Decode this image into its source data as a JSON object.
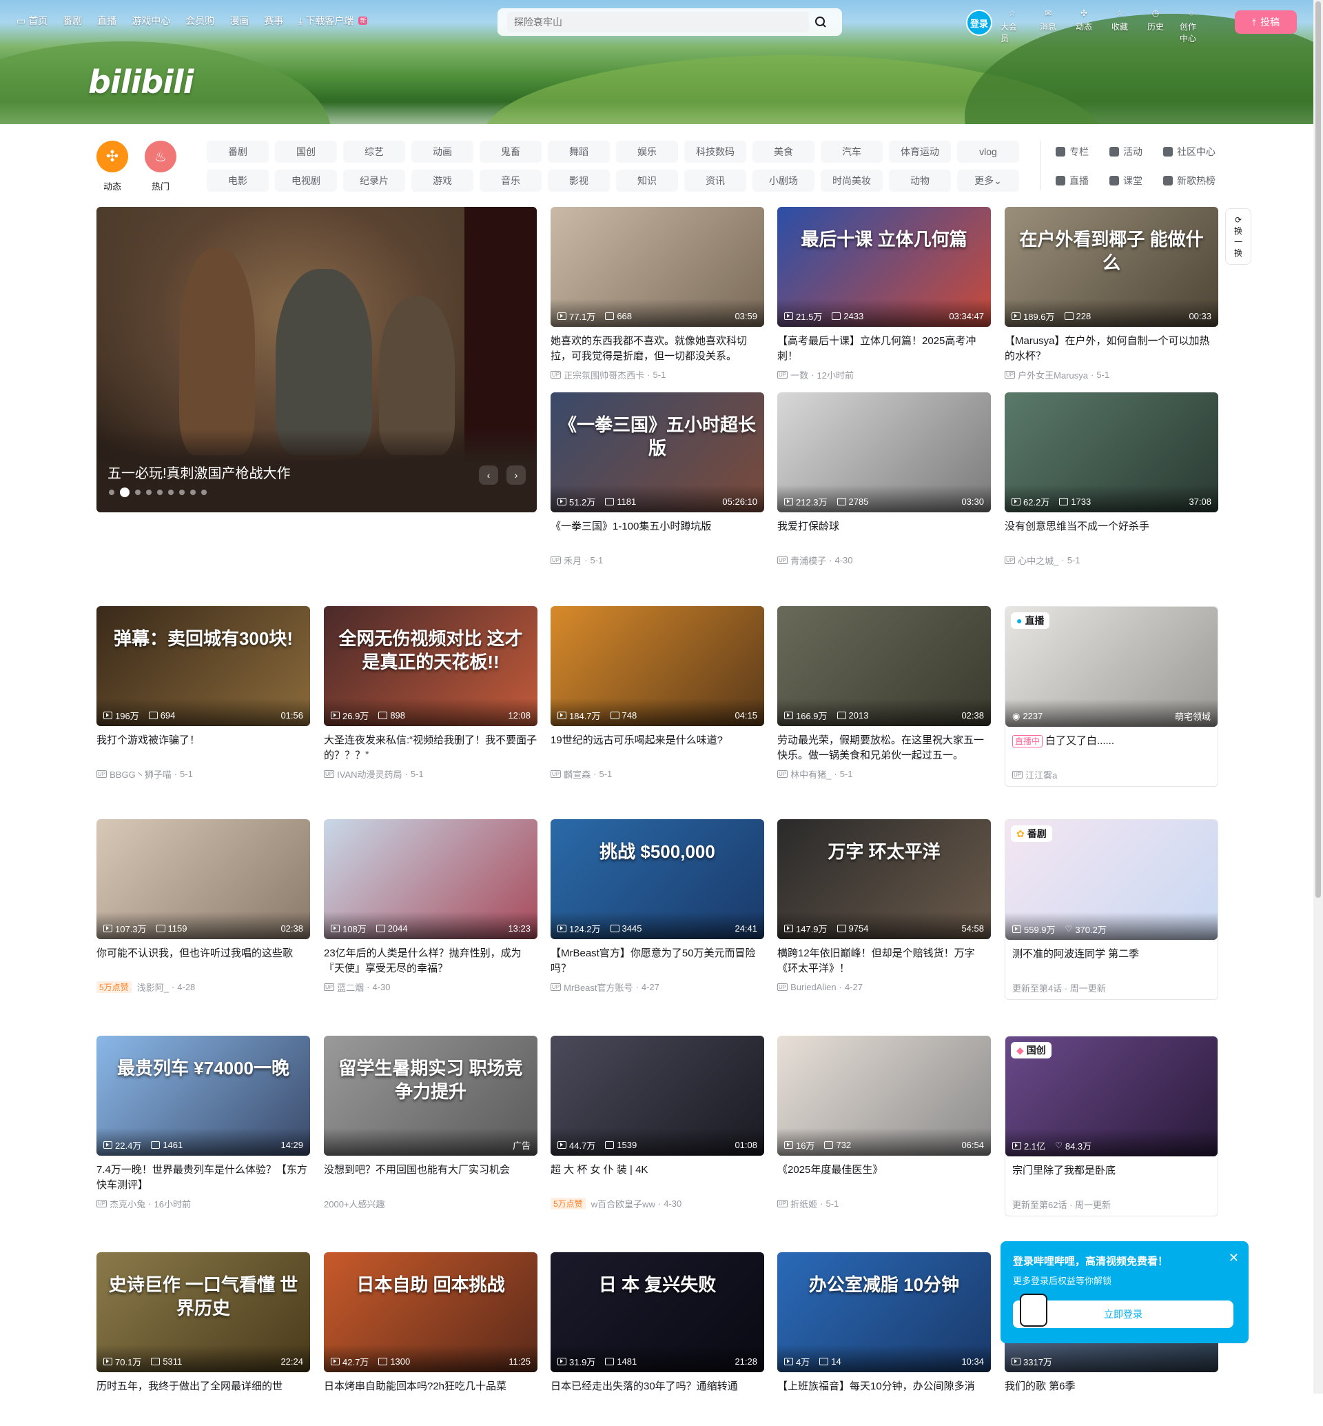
{
  "topnav": {
    "items": [
      "首页",
      "番剧",
      "直播",
      "游戏中心",
      "会员购",
      "漫画",
      "赛事",
      "下载客户端"
    ],
    "new_badge": "新"
  },
  "search": {
    "placeholder": "探险衰牢山"
  },
  "user": {
    "login": "登录",
    "items": [
      "大会员",
      "消息",
      "动态",
      "收藏",
      "历史",
      "创作中心"
    ],
    "upload": "投稿"
  },
  "logo": "bilibili",
  "channels": {
    "big": [
      "动态",
      "热门"
    ],
    "tags": [
      "番剧",
      "国创",
      "综艺",
      "动画",
      "鬼畜",
      "舞蹈",
      "娱乐",
      "科技数码",
      "美食",
      "汽车",
      "体育运动",
      "vlog",
      "电影",
      "电视剧",
      "纪录片",
      "游戏",
      "音乐",
      "影视",
      "知识",
      "资讯",
      "小剧场",
      "时尚美妆",
      "动物",
      "更多"
    ],
    "links": [
      "专栏",
      "活动",
      "社区中心",
      "直播",
      "课堂",
      "新歌热榜"
    ]
  },
  "carousel": {
    "title": "五一必玩!真刺激国产枪战大作",
    "dots": 9,
    "active": 1
  },
  "refresh": [
    "换",
    "一",
    "换"
  ],
  "cards": [
    {
      "views": "77.1万",
      "dm": "668",
      "dur": "03:59",
      "title": "她喜欢的东西我都不喜欢。就像她喜欢科切拉，可我觉得是折磨，但一切都没关系。",
      "up": "正宗氛围帅哥杰西卡",
      "date": "5-1",
      "c1": "#c9b9a6",
      "c2": "#7a6a58"
    },
    {
      "views": "21.5万",
      "dm": "2433",
      "dur": "03:34:47",
      "title": "【高考最后十课】立体几何篇！2025高考冲刺！",
      "up": "一数",
      "date": "12小时前",
      "c1": "#2b4fa8",
      "c2": "#c94a3a",
      "overlay": "最后十课 立体几何篇"
    },
    {
      "views": "189.6万",
      "dm": "228",
      "dur": "00:33",
      "title": "【Marusya】在户外，如何自制一个可以加热的水杯？",
      "up": "户外女王Marusya",
      "date": "5-1",
      "c1": "#9a8f7a",
      "c2": "#4e4536",
      "overlay": "在户外看到椰子 能做什么"
    },
    {
      "views": "51.2万",
      "dm": "1181",
      "dur": "05:26:10",
      "title": "《一拳三国》1-100集五小时蹲坑版",
      "up": "禾月",
      "date": "5-1",
      "c1": "#3a4a6a",
      "c2": "#7a4a3a",
      "overlay": "《一拳三国》五小时超长版"
    },
    {
      "views": "212.3万",
      "dm": "2785",
      "dur": "03:30",
      "title": "我爱打保龄球",
      "up": "青浦模子",
      "date": "4-30",
      "c1": "#d8d8d8",
      "c2": "#7a7a7a"
    },
    {
      "views": "62.2万",
      "dm": "1733",
      "dur": "37:08",
      "title": "没有创意思维当不成一个好杀手",
      "up": "心中之城_",
      "date": "5-1",
      "c1": "#5a7a6a",
      "c2": "#2a3a32"
    },
    {
      "views": "196万",
      "dm": "694",
      "dur": "01:56",
      "title": "我打个游戏被诈骗了！",
      "up": "BBGG丶狮子喵",
      "date": "5-1",
      "c1": "#3a2a1a",
      "c2": "#8a6a3a",
      "overlay": "弹幕：卖回城有300块!"
    },
    {
      "views": "26.9万",
      "dm": "898",
      "dur": "12:08",
      "title": "大圣连夜发来私信:“视频给我删了！我不要面子的？？？”",
      "up": "IVAN动漫灵药局",
      "date": "5-1",
      "c1": "#4a2a2a",
      "c2": "#c25a3a",
      "overlay": "全网无伤视频对比 这才是真正的天花板!!"
    },
    {
      "views": "184.7万",
      "dm": "748",
      "dur": "04:15",
      "title": "19世纪的远古可乐喝起来是什么味道?",
      "up": "麟宣森",
      "date": "5-1",
      "c1": "#d88a2a",
      "c2": "#5a3a1a"
    },
    {
      "views": "166.9万",
      "dm": "2013",
      "dur": "02:38",
      "title": "劳动最光荣，假期要放松。在这里祝大家五一快乐。做一锅美食和兄弟伙一起过五一。",
      "up": "林中有猪_",
      "date": "5-1",
      "c1": "#6a6a5a",
      "c2": "#3a3a2e"
    },
    {
      "views": "559.9万",
      "dm": "370.2万",
      "dur": "",
      "title": "测不准的阿波连同学 第二季",
      "up": "",
      "date": "",
      "meta": "更新至第4话 · 周一更新",
      "c1": "#f4e6f2",
      "c2": "#c8d8f2",
      "corner": "番剧",
      "like": true
    },
    {
      "views": "107.3万",
      "dm": "1159",
      "dur": "02:38",
      "title": "你可能不认识我，但也许听过我唱的这些歌",
      "up": "浅影阿_",
      "date": "4-28",
      "hot": "5万点赞",
      "c1": "#d8c8b8",
      "c2": "#8a7a6a"
    },
    {
      "views": "108万",
      "dm": "2044",
      "dur": "13:23",
      "title": "23亿年后的人类是什么样？抛弃性别，成为『天使』享受无尽的幸福？",
      "up": "蓝二烟",
      "date": "4-30",
      "c1": "#c8d8e8",
      "c2": "#a84a5a"
    },
    {
      "views": "124.2万",
      "dm": "3445",
      "dur": "24:41",
      "title": "【MrBeast官方】你愿意为了50万美元而冒险吗？",
      "up": "MrBeast官方账号",
      "date": "4-27",
      "c1": "#2a6aa8",
      "c2": "#1a3a6a",
      "overlay": "挑战 $500,000"
    },
    {
      "views": "147.9万",
      "dm": "9754",
      "dur": "54:58",
      "title": "横跨12年依旧巅峰！但却是个赔钱货！万字《环太平洋》！",
      "up": "BuriedAlien",
      "date": "4-27",
      "c1": "#2a2a2a",
      "c2": "#6a5a4a",
      "overlay": "万字 环太平洋"
    },
    {
      "views": "44.7万",
      "dm": "1539",
      "dur": "01:08",
      "title": "超 大 杯 女 仆 装 | 4K",
      "up": "w百合欧皇子ww",
      "date": "4-30",
      "hot": "5万点赞",
      "c1": "#4a4a5a",
      "c2": "#1a1a22"
    },
    {
      "views": "22.4万",
      "dm": "1461",
      "dur": "14:29",
      "title": "7.4万一晚！世界最贵列车是什么体验？【东方快车测评】",
      "up": "杰克小兔",
      "date": "16小时前",
      "c1": "#8ab8e8",
      "c2": "#3a4a6a",
      "overlay": "最贵列车 ¥74000一晚"
    },
    {
      "views": "",
      "dm": "",
      "dur": "广告",
      "title": "没想到吧？不用回国也能有大厂实习机会",
      "up": "",
      "date": "",
      "meta": "2000+人感兴趣",
      "c1": "#9a9a9a",
      "c2": "#5a5a5a",
      "overlay": "留学生暑期实习 职场竞争力提升",
      "ad": true
    },
    {
      "views": "16万",
      "dm": "732",
      "dur": "06:54",
      "title": "《2025年度最佳医生》",
      "up": "折纸姬",
      "date": "5-1",
      "c1": "#e8e0d8",
      "c2": "#8a8a8a"
    },
    {
      "views": "2.1亿",
      "dm": "84.3万",
      "dur": "",
      "title": "宗门里除了我都是卧底",
      "up": "",
      "date": "",
      "meta": "更新至第62话 · 周一更新",
      "c1": "#6a4a8a",
      "c2": "#2a1a3a",
      "corner": "国创",
      "like": true
    },
    {
      "views": "70.1万",
      "dm": "5311",
      "dur": "22:24",
      "title": "历时五年，我终于做出了全网最详细的世",
      "up": "",
      "date": "",
      "c1": "#8a7a4a",
      "c2": "#4a3a1a",
      "overlay": "史诗巨作 一口气看懂 世界历史"
    },
    {
      "views": "42.7万",
      "dm": "1300",
      "dur": "11:25",
      "title": "日本烤串自助能回本吗?2h狂吃几十品菜",
      "up": "",
      "date": "",
      "c1": "#c85a2a",
      "c2": "#5a2a1a",
      "overlay": "日本自助 回本挑战"
    },
    {
      "views": "31.9万",
      "dm": "1481",
      "dur": "21:28",
      "title": "日本已经走出失落的30年了吗？通缩转通",
      "up": "",
      "date": "",
      "c1": "#1a1a2a",
      "c2": "#0a0a14",
      "overlay": "日 本 复兴失败"
    },
    {
      "views": "4万",
      "dm": "14",
      "dur": "10:34",
      "title": "【上班族福音】每天10分钟，办公间隙多消",
      "up": "",
      "date": "",
      "c1": "#2a6ab8",
      "c2": "#1a3a6a",
      "overlay": "办公室减脂 10分钟"
    },
    {
      "views": "3317万",
      "dm": "",
      "dur": "",
      "title": "我们的歌 第6季",
      "up": "",
      "date": "",
      "c1": "#5a6a8a",
      "c2": "#2a3a4a"
    }
  ],
  "live_card": {
    "views": "2237",
    "channel": "萌宅领域",
    "badge": "直播中",
    "title": "白了又了白......",
    "up": "江江雾a",
    "corner": "直播"
  },
  "login_pop": {
    "title": "登录哔哩哔哩，高清视频免费看！",
    "sub": "更多登录后权益等你解锁",
    "btn": "立即登录"
  },
  "colors": {
    "brand_pink": "#fb7299",
    "brand_blue": "#00aeec",
    "hot_orange": "#ff7f24"
  }
}
